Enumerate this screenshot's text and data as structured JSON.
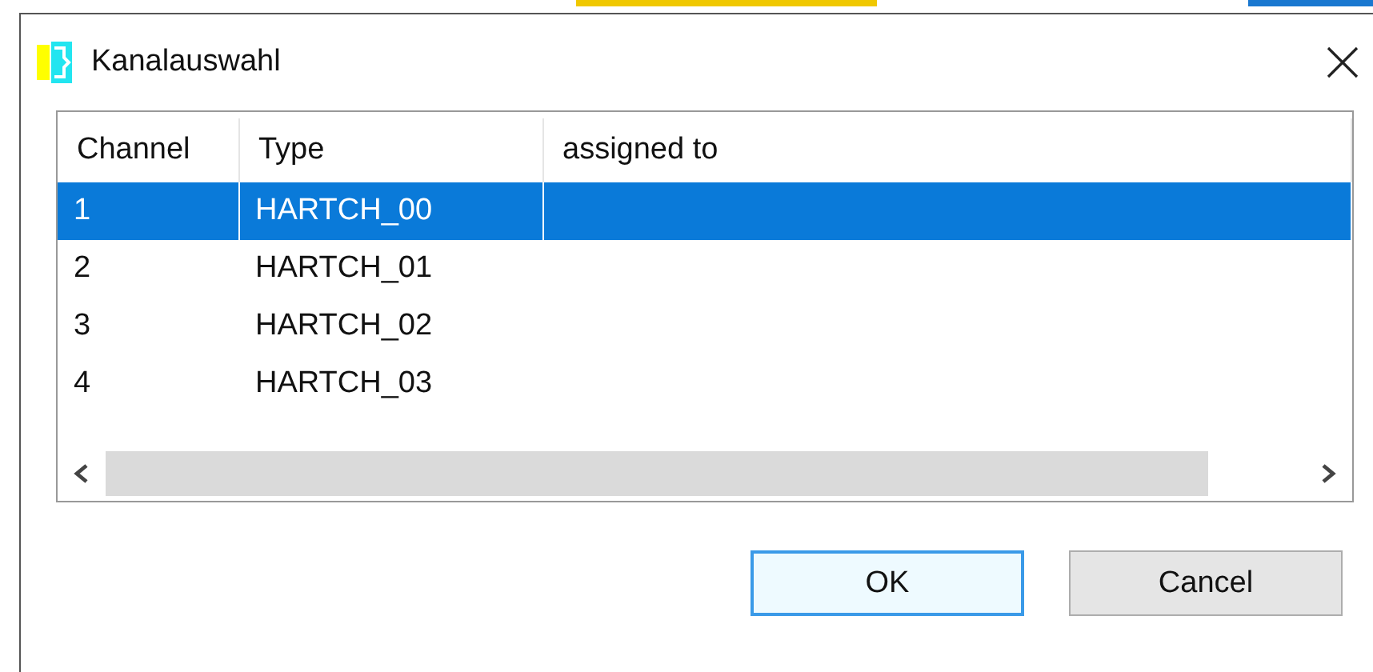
{
  "window": {
    "title": "Kanalauswahl"
  },
  "table": {
    "columns": [
      "Channel",
      "Type",
      "assigned to"
    ],
    "rows": [
      {
        "channel": "1",
        "type": "HARTCH_00",
        "selected": true
      },
      {
        "channel": "2",
        "type": "HARTCH_01",
        "selected": false
      },
      {
        "channel": "3",
        "type": "HARTCH_02",
        "selected": false
      },
      {
        "channel": "4",
        "type": "HARTCH_03",
        "selected": false
      }
    ]
  },
  "buttons": [
    {
      "label": "OK",
      "default": true
    },
    {
      "label": "Cancel",
      "default": false
    }
  ]
}
